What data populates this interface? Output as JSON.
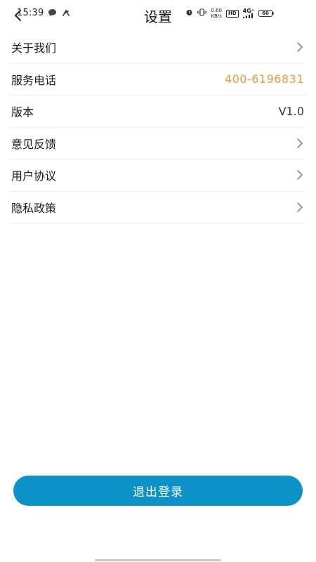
{
  "status_bar": {
    "time": "15:39",
    "net_speed_value": "0.60",
    "net_speed_unit": "KB/s",
    "hd_badge": "HD",
    "network_type": "4G⁺",
    "battery_level": "60"
  },
  "header": {
    "title": "设置"
  },
  "settings": {
    "items": [
      {
        "label": "关于我们",
        "value": "",
        "has_chevron": true
      },
      {
        "label": "服务电话",
        "value": "400-6196831",
        "has_chevron": false
      },
      {
        "label": "版本",
        "value": "V1.0",
        "has_chevron": false
      },
      {
        "label": "意见反馈",
        "value": "",
        "has_chevron": true
      },
      {
        "label": "用户协议",
        "value": "",
        "has_chevron": true
      },
      {
        "label": "隐私政策",
        "value": "",
        "has_chevron": true
      }
    ]
  },
  "logout": {
    "label": "退出登录"
  },
  "colors": {
    "accent_phone": "#E89A3C",
    "logout_bg": "#0B93C8"
  }
}
